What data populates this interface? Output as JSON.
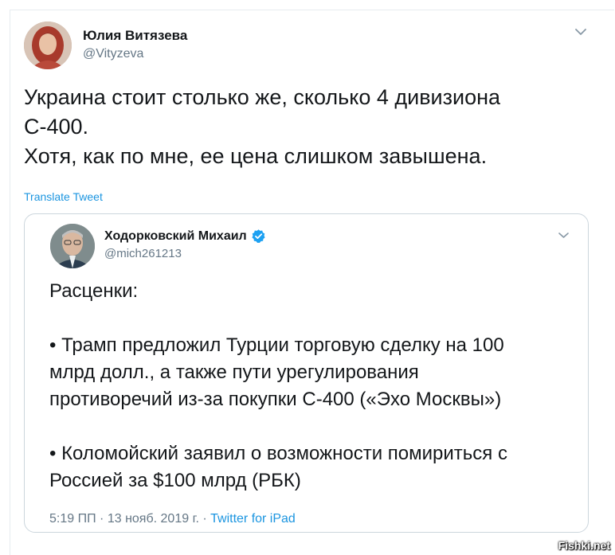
{
  "tweet": {
    "author_name": "Юлия Витязева",
    "author_handle": "@Vityzeva",
    "text_lines": [
      "Украина стоит столько же, сколько 4 дивизиона",
      "С-400.",
      "Хотя, как по мне, ее цена слишком завышена."
    ],
    "translate_label": "Translate Tweet"
  },
  "quoted_tweet": {
    "author_name": "Ходорковский Михаил",
    "author_handle": "@mich261213",
    "verified": true,
    "paragraphs": [
      [
        "Расценки:"
      ],
      [
        "• Трамп предложил Турции торговую сделку на 100",
        "млрд долл., а также пути урегулирования",
        "противоречий из-за покупки С-400 («Эхо Москвы»)"
      ],
      [
        "• Коломойский заявил о возможности помириться с",
        "Россией за $100 млрд (РБК)"
      ]
    ],
    "time": "5:19 ПП",
    "date": "13 нояб. 2019 г.",
    "separator": "·",
    "source": "Twitter for iPad"
  },
  "watermark": "Fishki.net",
  "icons": {
    "chevron": "chevron-down-icon",
    "verified": "verified-badge-icon"
  },
  "colors": {
    "link": "#1b95e0",
    "muted": "#657786",
    "text": "#14171a",
    "border": "#ccd6dd",
    "verified": "#1da1f2"
  }
}
